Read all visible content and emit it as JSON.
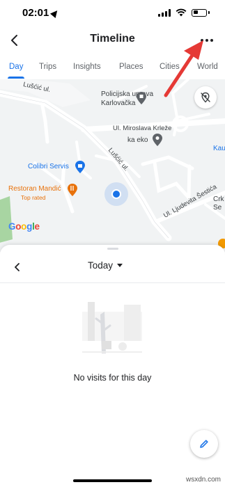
{
  "status_bar": {
    "time": "02:01"
  },
  "app_bar": {
    "title": "Timeline"
  },
  "tabs": [
    {
      "label": "Day",
      "active": true
    },
    {
      "label": "Trips",
      "active": false
    },
    {
      "label": "Insights",
      "active": false
    },
    {
      "label": "Places",
      "active": false
    },
    {
      "label": "Cities",
      "active": false
    },
    {
      "label": "World",
      "active": false
    }
  ],
  "map": {
    "labels": {
      "street_luscic_left": "Lušćić ul.",
      "police_line1": "Policijska uprava",
      "police_line2": "Karlovačka",
      "street_krleze": "Ul. Miroslava Krleže",
      "ka_eko": "ka eko",
      "street_luscic_diag": "Lušćić ul.",
      "colibri": "Colibri Servis",
      "restoran": "Restoran Mandić",
      "restoran_sub": "Top rated",
      "street_sestica": "Ul. Ljudevita Šestića",
      "edge_kau": "Kau",
      "edge_crk_1": "Crk",
      "edge_crk_2": "Se"
    },
    "google_logo": "Google"
  },
  "sheet": {
    "date_label": "Today",
    "empty_message": "No visits for this day"
  },
  "watermark": "wsxdn.com",
  "colors": {
    "accent": "#1a73e8",
    "annotation_arrow": "#e53935"
  }
}
